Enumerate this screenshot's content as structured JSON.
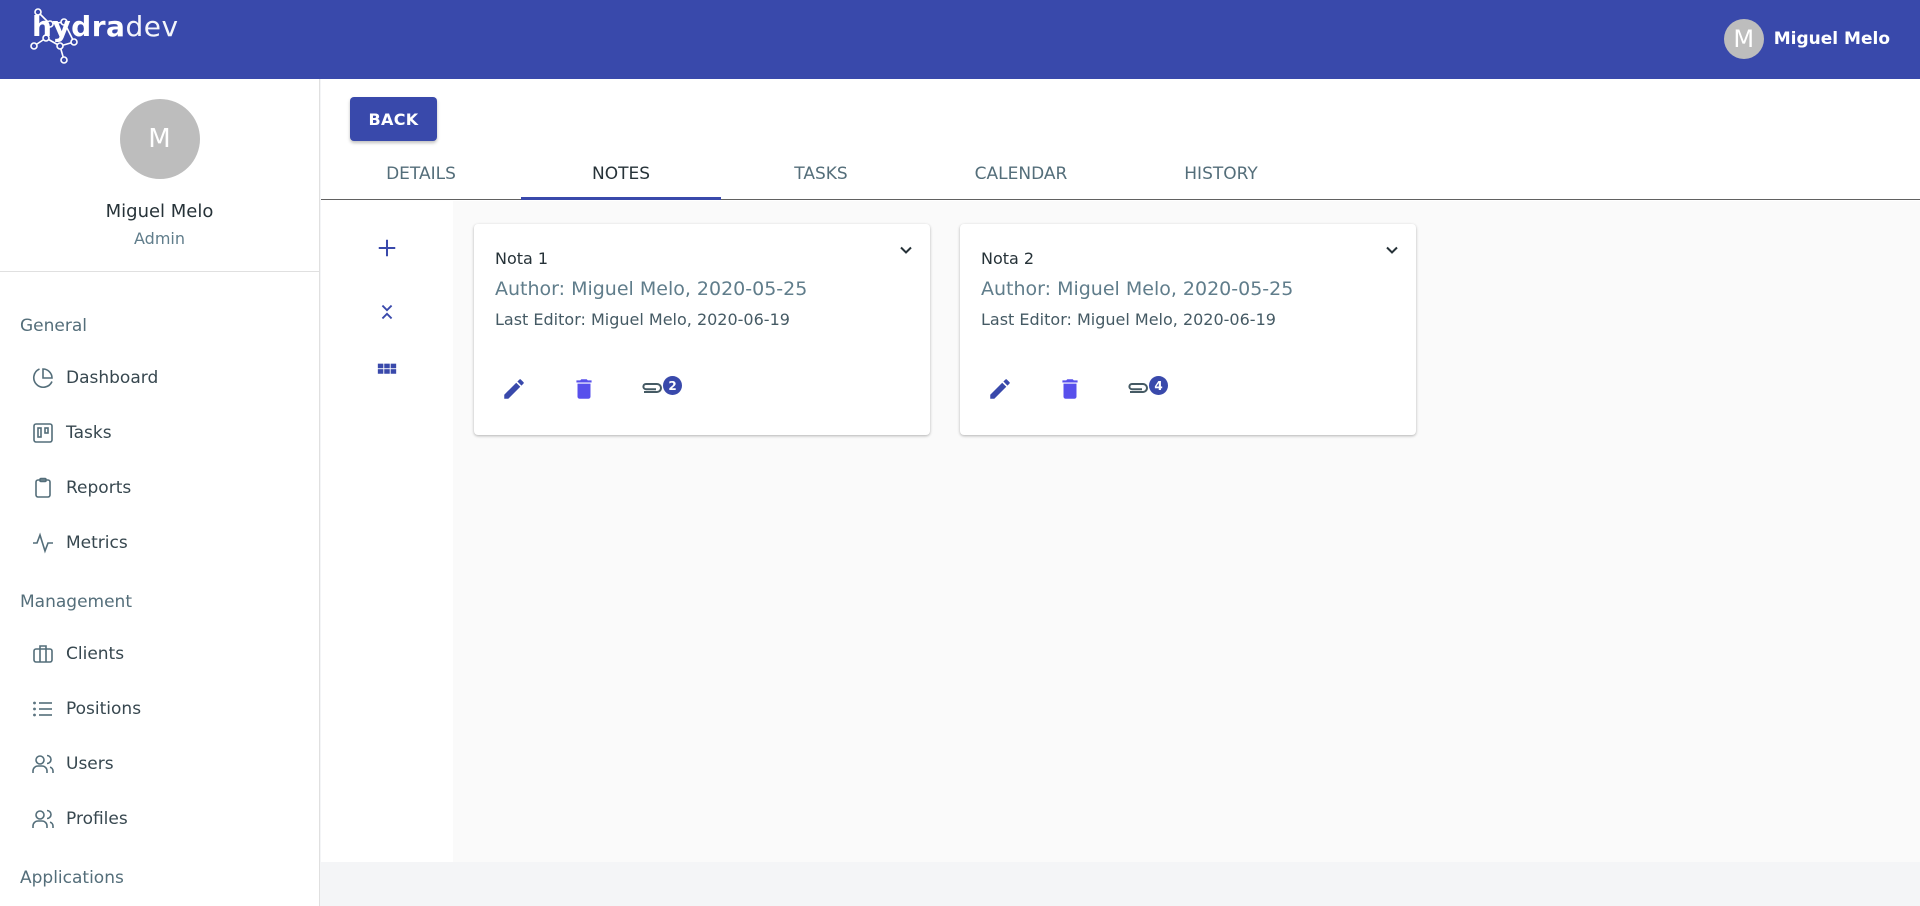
{
  "topbar": {
    "logo_bold": "hydra",
    "logo_thin": "dev",
    "user_initial": "M",
    "user_name": "Miguel Melo",
    "color": "#3949ab"
  },
  "sidebar": {
    "profile": {
      "initial": "M",
      "name": "Miguel Melo",
      "role": "Admin"
    },
    "sections": [
      {
        "title": "General",
        "items": [
          {
            "label": "Dashboard",
            "icon": "pie-chart-icon"
          },
          {
            "label": "Tasks",
            "icon": "kanban-icon"
          },
          {
            "label": "Reports",
            "icon": "clipboard-icon"
          },
          {
            "label": "Metrics",
            "icon": "activity-icon"
          }
        ]
      },
      {
        "title": "Management",
        "items": [
          {
            "label": "Clients",
            "icon": "briefcase-icon"
          },
          {
            "label": "Positions",
            "icon": "list-icon"
          },
          {
            "label": "Users",
            "icon": "users-icon"
          },
          {
            "label": "Profiles",
            "icon": "users-icon"
          }
        ]
      },
      {
        "title": "Applications",
        "items": []
      }
    ]
  },
  "main": {
    "back_label": "BACK",
    "tabs": [
      {
        "label": "DETAILS",
        "active": false
      },
      {
        "label": "NOTES",
        "active": true
      },
      {
        "label": "TASKS",
        "active": false
      },
      {
        "label": "CALENDAR",
        "active": false
      },
      {
        "label": "HISTORY",
        "active": false
      }
    ],
    "tools": [
      "add-icon",
      "collapse-all-icon",
      "grid-view-icon"
    ],
    "notes": [
      {
        "title": "Nota 1",
        "author": "Author: Miguel Melo, 2020-05-25",
        "editor": "Last Editor: Miguel Melo, 2020-06-19",
        "attachments": "2"
      },
      {
        "title": "Nota 2",
        "author": "Author: Miguel Melo, 2020-05-25",
        "editor": "Last Editor: Miguel Melo, 2020-06-19",
        "attachments": "4"
      }
    ]
  }
}
